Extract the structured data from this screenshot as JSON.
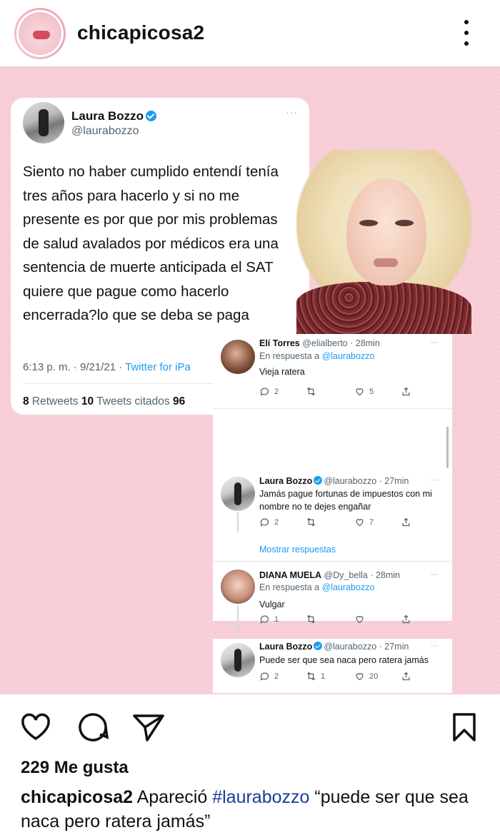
{
  "header": {
    "username": "chicapicosa2",
    "avatar_icon": "profile-avatar-icon",
    "more_icon": "more-vertical-icon"
  },
  "tweet": {
    "name": "Laura Bozzo",
    "handle": "@laurabozzo",
    "more": "···",
    "text": "Siento no haber cumplido entendí tenía tres años para hacerlo y si no me presente es por que por mis problemas de salud avalados por médicos era una sentencia de muerte anticipada el SAT quiere que pague como hacerlo encerrada?lo que se deba se paga",
    "time": "6:13 p. m. · 9/21/21 · ",
    "source": "Twitter for iPa",
    "retweets_count": "8",
    "retweets_label": " Retweets ",
    "quotes_count": "10",
    "quotes_label": " Tweets citados ",
    "likes_count": "96"
  },
  "replies": {
    "items": [
      {
        "name": "Elí Torres",
        "handle": "@elialberto · 28min",
        "reply_prefix": "En respuesta a ",
        "reply_to": "@laurabozzo",
        "text": "Vieja ratera",
        "replies": "2",
        "retweets": "",
        "likes": "5"
      },
      {
        "name": "Laura Bozzo",
        "handle": "@laurabozzo · 27min",
        "text": "Jamás pague fortunas de impuestos con mi nombre no te dejes engañar",
        "replies": "2",
        "retweets": "",
        "likes": "7"
      },
      {
        "name": "DIANA MUELA",
        "handle": "@Dy_bella · 28min",
        "reply_prefix": "En respuesta a ",
        "reply_to": "@laurabozzo",
        "text": "Vulgar",
        "replies": "1",
        "retweets": "",
        "likes": ""
      },
      {
        "name": "Laura Bozzo",
        "handle": "@laurabozzo · 27min",
        "text": "Puede ser que sea naca pero ratera jamás",
        "replies": "2",
        "retweets": "1",
        "likes": "20"
      }
    ],
    "show_more": "Mostrar respuestas",
    "more": "···"
  },
  "actions": {
    "icons": [
      "heart-icon",
      "comment-icon",
      "share-icon",
      "bookmark-icon"
    ]
  },
  "likes_text": "229 Me gusta",
  "caption": {
    "username": "chicapicosa2",
    "before_tag": " Apareció ",
    "hashtag": "#laurabozzo",
    "after_tag": " “puede ser que sea naca  pero ratera jamás”"
  },
  "colors": {
    "post_background": "#f7cdd7",
    "twitter_blue": "#1d9bf0",
    "hashtag_blue": "#1a3d9b"
  }
}
